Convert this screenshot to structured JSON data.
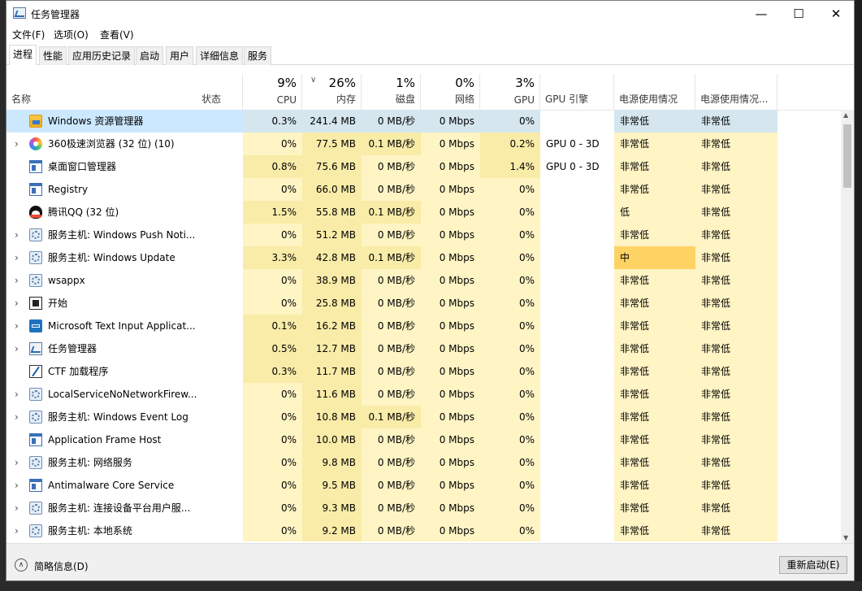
{
  "window": {
    "title": "任务管理器",
    "controls": [
      "minimize",
      "maximize",
      "close"
    ]
  },
  "menu": [
    "文件(F)",
    "选项(O)",
    "查看(V)"
  ],
  "tabs": [
    "进程",
    "性能",
    "应用历史记录",
    "启动",
    "用户",
    "详细信息",
    "服务"
  ],
  "active_tab": "进程",
  "header": {
    "name": "名称",
    "status": "状态",
    "cpu_pct": "9%",
    "cpu": "CPU",
    "mem_pct": "26%",
    "mem": "内存",
    "disk_pct": "1%",
    "disk": "磁盘",
    "net_pct": "0%",
    "net": "网络",
    "gpu_pct": "3%",
    "gpu": "GPU",
    "gpu_engine": "GPU 引擎",
    "power": "电源使用情况",
    "power_trend": "电源使用情况..."
  },
  "rows": [
    {
      "icon": "folder-icon",
      "expand": false,
      "name": "Windows 资源管理器",
      "cpu": "0.3%",
      "mem": "241.4 MB",
      "disk": "0 MB/秒",
      "net": "0 Mbps",
      "gpu": "0%",
      "engine": "",
      "power": "非常低",
      "trend": "非常低",
      "selected": true
    },
    {
      "icon": "browser-360-icon",
      "expand": true,
      "name": "360极速浏览器 (32 位) (10)",
      "cpu": "0%",
      "mem": "77.5 MB",
      "disk": "0.1 MB/秒",
      "net": "0 Mbps",
      "gpu": "0.2%",
      "engine": "GPU 0 - 3D",
      "power": "非常低",
      "trend": "非常低"
    },
    {
      "icon": "window-icon",
      "expand": false,
      "name": "桌面窗口管理器",
      "cpu": "0.8%",
      "mem": "75.6 MB",
      "disk": "0 MB/秒",
      "net": "0 Mbps",
      "gpu": "1.4%",
      "engine": "GPU 0 - 3D",
      "power": "非常低",
      "trend": "非常低"
    },
    {
      "icon": "window-icon",
      "expand": false,
      "name": "Registry",
      "cpu": "0%",
      "mem": "66.0 MB",
      "disk": "0 MB/秒",
      "net": "0 Mbps",
      "gpu": "0%",
      "engine": "",
      "power": "非常低",
      "trend": "非常低"
    },
    {
      "icon": "qq-icon",
      "expand": false,
      "name": "腾讯QQ (32 位)",
      "cpu": "1.5%",
      "mem": "55.8 MB",
      "disk": "0.1 MB/秒",
      "net": "0 Mbps",
      "gpu": "0%",
      "engine": "",
      "power": "低",
      "trend": "非常低"
    },
    {
      "icon": "gear-icon",
      "expand": true,
      "name": "服务主机: Windows Push Noti...",
      "cpu": "0%",
      "mem": "51.2 MB",
      "disk": "0 MB/秒",
      "net": "0 Mbps",
      "gpu": "0%",
      "engine": "",
      "power": "非常低",
      "trend": "非常低"
    },
    {
      "icon": "gear-icon",
      "expand": true,
      "name": "服务主机: Windows Update",
      "cpu": "3.3%",
      "mem": "42.8 MB",
      "disk": "0.1 MB/秒",
      "net": "0 Mbps",
      "gpu": "0%",
      "engine": "",
      "power": "中",
      "trend": "非常低",
      "power_level": "mid"
    },
    {
      "icon": "gear-icon",
      "expand": true,
      "name": "wsappx",
      "cpu": "0%",
      "mem": "38.9 MB",
      "disk": "0 MB/秒",
      "net": "0 Mbps",
      "gpu": "0%",
      "engine": "",
      "power": "非常低",
      "trend": "非常低"
    },
    {
      "icon": "start-icon",
      "expand": true,
      "name": "开始",
      "cpu": "0%",
      "mem": "25.8 MB",
      "disk": "0 MB/秒",
      "net": "0 Mbps",
      "gpu": "0%",
      "engine": "",
      "power": "非常低",
      "trend": "非常低"
    },
    {
      "icon": "keyboard-icon",
      "expand": true,
      "name": "Microsoft Text Input Applicat...",
      "cpu": "0.1%",
      "mem": "16.2 MB",
      "disk": "0 MB/秒",
      "net": "0 Mbps",
      "gpu": "0%",
      "engine": "",
      "power": "非常低",
      "trend": "非常低"
    },
    {
      "icon": "task-manager-icon",
      "expand": true,
      "name": "任务管理器",
      "cpu": "0.5%",
      "mem": "12.7 MB",
      "disk": "0 MB/秒",
      "net": "0 Mbps",
      "gpu": "0%",
      "engine": "",
      "power": "非常低",
      "trend": "非常低"
    },
    {
      "icon": "ctf-icon",
      "expand": false,
      "name": "CTF 加载程序",
      "cpu": "0.3%",
      "mem": "11.7 MB",
      "disk": "0 MB/秒",
      "net": "0 Mbps",
      "gpu": "0%",
      "engine": "",
      "power": "非常低",
      "trend": "非常低"
    },
    {
      "icon": "gear-icon",
      "expand": true,
      "name": "LocalServiceNoNetworkFirew...",
      "cpu": "0%",
      "mem": "11.6 MB",
      "disk": "0 MB/秒",
      "net": "0 Mbps",
      "gpu": "0%",
      "engine": "",
      "power": "非常低",
      "trend": "非常低"
    },
    {
      "icon": "gear-icon",
      "expand": true,
      "name": "服务主机: Windows Event Log",
      "cpu": "0%",
      "mem": "10.8 MB",
      "disk": "0.1 MB/秒",
      "net": "0 Mbps",
      "gpu": "0%",
      "engine": "",
      "power": "非常低",
      "trend": "非常低"
    },
    {
      "icon": "window-icon",
      "expand": false,
      "name": "Application Frame Host",
      "cpu": "0%",
      "mem": "10.0 MB",
      "disk": "0 MB/秒",
      "net": "0 Mbps",
      "gpu": "0%",
      "engine": "",
      "power": "非常低",
      "trend": "非常低"
    },
    {
      "icon": "gear-icon",
      "expand": true,
      "name": "服务主机: 网络服务",
      "cpu": "0%",
      "mem": "9.8 MB",
      "disk": "0 MB/秒",
      "net": "0 Mbps",
      "gpu": "0%",
      "engine": "",
      "power": "非常低",
      "trend": "非常低"
    },
    {
      "icon": "window-icon",
      "expand": true,
      "name": "Antimalware Core Service",
      "cpu": "0%",
      "mem": "9.5 MB",
      "disk": "0 MB/秒",
      "net": "0 Mbps",
      "gpu": "0%",
      "engine": "",
      "power": "非常低",
      "trend": "非常低"
    },
    {
      "icon": "gear-icon",
      "expand": true,
      "name": "服务主机: 连接设备平台用户服...",
      "cpu": "0%",
      "mem": "9.3 MB",
      "disk": "0 MB/秒",
      "net": "0 Mbps",
      "gpu": "0%",
      "engine": "",
      "power": "非常低",
      "trend": "非常低"
    },
    {
      "icon": "gear-icon",
      "expand": true,
      "name": "服务主机: 本地系统",
      "cpu": "0%",
      "mem": "9.2 MB",
      "disk": "0 MB/秒",
      "net": "0 Mbps",
      "gpu": "0%",
      "engine": "",
      "power": "非常低",
      "trend": "非常低"
    }
  ],
  "footer": {
    "fewer_details": "简略信息(D)",
    "restart": "重新启动(E)"
  },
  "colors": {
    "heat_light": "#fff4c4",
    "heat_mid": "#f9eca8",
    "heat_strong": "#ffd264",
    "selected_row": "#cce8ff",
    "selected_heat": "#d5e6ef"
  }
}
